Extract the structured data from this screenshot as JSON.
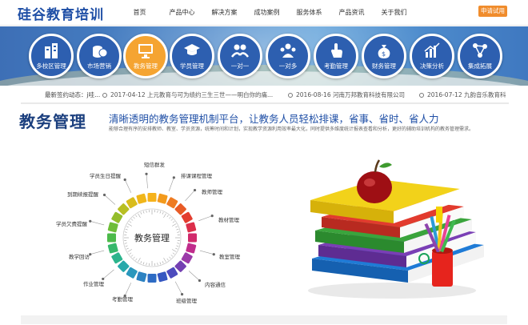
{
  "header": {
    "logo": "硅谷教育培训",
    "nav": [
      "首页",
      "产品中心",
      "解决方案",
      "成功案例",
      "服务体系",
      "产品资讯",
      "关于我们"
    ],
    "cta": "申请试用"
  },
  "modules": [
    {
      "label": "多校区管理",
      "icon": "buildings-icon",
      "active": false
    },
    {
      "label": "市场营销",
      "icon": "coins-icon",
      "active": false
    },
    {
      "label": "教务管理",
      "icon": "monitor-icon",
      "active": true
    },
    {
      "label": "学员管理",
      "icon": "graduation-cap-icon",
      "active": false
    },
    {
      "label": "一对一",
      "icon": "one-to-one-icon",
      "active": false
    },
    {
      "label": "一对多",
      "icon": "group-icon",
      "active": false
    },
    {
      "label": "考勤管理",
      "icon": "hand-pointer-icon",
      "active": false
    },
    {
      "label": "财务管理",
      "icon": "money-bag-icon",
      "active": false
    },
    {
      "label": "决策分析",
      "icon": "bar-chart-icon",
      "active": false
    },
    {
      "label": "集成拓展",
      "icon": "network-icon",
      "active": false
    }
  ],
  "ticker": {
    "label": "最新签约动态：",
    "fragment": "j哇...",
    "items": [
      "2017-04-12 上元教育与可为绩约三生三世——明白你的痛...",
      "2016-08-16 河南万邦教育科技有限公司",
      "2016-07-12 九韵音乐教育科"
    ]
  },
  "section": {
    "title": "教务管理",
    "subtitle": "清晰透明的教务管理机制平台，让教务人员轻松排课，省事、省时、省人力",
    "description": "能够合理有序的安排教师、教室、学员资源，统筹时间和计划，实现教学资源利用效率最大化，同时提供多维度统计报表查看和分析，更好的辅助培训机构的教务管理需求。"
  },
  "diagram": {
    "center": "教务管理",
    "labels": [
      "短信群发",
      "排课课程管理",
      "教师管理",
      "教材管理",
      "教室管理",
      "内容通信",
      "班级管理",
      "考勤管理",
      "作业管理",
      "教学回访",
      "学员欠费提醒",
      "到期续报提醒",
      "学员生日提醒"
    ]
  }
}
